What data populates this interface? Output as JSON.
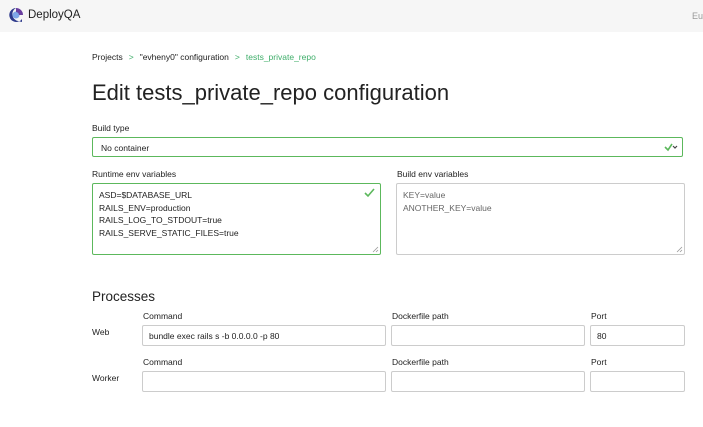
{
  "app": {
    "name": "DeployQA",
    "topright_text": "Eu"
  },
  "breadcrumb": {
    "items": [
      "Projects",
      "\"evheny0\" configuration",
      "tests_private_repo"
    ],
    "separator": ">"
  },
  "page_title": "Edit tests_private_repo configuration",
  "build_type": {
    "label": "Build type",
    "value": "No container"
  },
  "runtime_env": {
    "label": "Runtime env variables",
    "lines": [
      "ASD=$DATABASE_URL",
      "RAILS_ENV=production",
      "RAILS_LOG_TO_STDOUT=true",
      "RAILS_SERVE_STATIC_FILES=true"
    ]
  },
  "build_env": {
    "label": "Build env variables",
    "lines": [
      "KEY=value",
      "ANOTHER_KEY=value"
    ]
  },
  "processes": {
    "title": "Processes",
    "rows": [
      {
        "name": "Web",
        "command_label": "Command",
        "dockerfile_label": "Dockerfile path",
        "port_label": "Port",
        "command": "bundle exec rails s -b 0.0.0.0 -p 80",
        "dockerfile": "",
        "port": "80"
      },
      {
        "name": "Worker",
        "command_label": "Command",
        "dockerfile_label": "Dockerfile path",
        "port_label": "Port",
        "command": "",
        "dockerfile": "",
        "port": ""
      }
    ]
  },
  "colors": {
    "accent": "#3fae6a",
    "valid_border": "#5cb85c",
    "logo_primary": "#2f3b8c",
    "logo_secondary": "#7fa7e8"
  }
}
